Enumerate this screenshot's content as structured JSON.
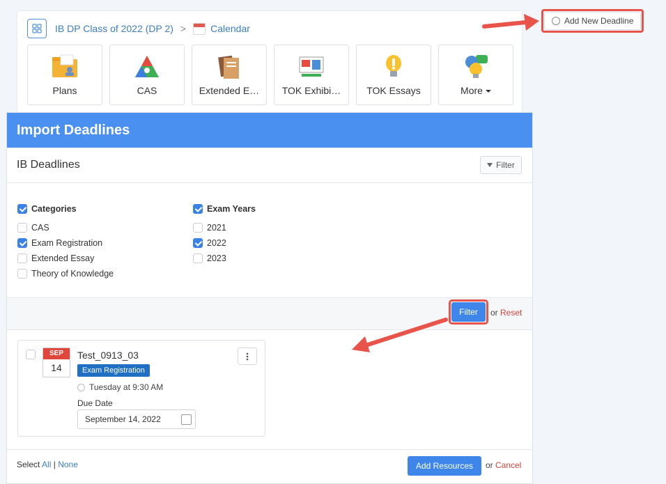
{
  "breadcrumb": {
    "class_name": "IB DP Class of 2022 (DP 2)",
    "separator": ">",
    "current": "Calendar"
  },
  "tiles": [
    {
      "label": "Plans",
      "icon": "folder-plans-icon"
    },
    {
      "label": "CAS",
      "icon": "cas-triangle-icon"
    },
    {
      "label": "Extended E…",
      "icon": "books-icon"
    },
    {
      "label": "TOK Exhibi…",
      "icon": "exhibition-board-icon"
    },
    {
      "label": "TOK Essays",
      "icon": "lightbulb-icon"
    },
    {
      "label": "More",
      "icon": "chat-bulb-icon"
    }
  ],
  "add_deadline_label": "Add New Deadline",
  "modal": {
    "title": "Import Deadlines",
    "subtitle": "IB Deadlines",
    "filter_small_label": "Filter",
    "categories": {
      "heading": "Categories",
      "items": [
        {
          "label": "CAS",
          "checked": false
        },
        {
          "label": "Exam Registration",
          "checked": true
        },
        {
          "label": "Extended Essay",
          "checked": false
        },
        {
          "label": "Theory of Knowledge",
          "checked": false
        }
      ]
    },
    "exam_years": {
      "heading": "Exam Years",
      "items": [
        {
          "label": "2021",
          "checked": false
        },
        {
          "label": "2022",
          "checked": true
        },
        {
          "label": "2023",
          "checked": false
        }
      ]
    },
    "filter_button": "Filter",
    "or_text": "or",
    "reset_link": "Reset",
    "card": {
      "month": "SEP",
      "day": "14",
      "title": "Test_0913_03",
      "tag": "Exam Registration",
      "time": "Tuesday at 9:30 AM",
      "due_label": "Due Date",
      "due_value": "September 14, 2022"
    },
    "footer": {
      "select_text": "Select",
      "all_link": "All",
      "sep": "|",
      "none_link": "None",
      "add_button": "Add Resources",
      "or_text": "or",
      "cancel_link": "Cancel"
    }
  },
  "colors": {
    "header_blue": "#4a90f0",
    "highlight_red": "#e8534a",
    "link_blue": "#3a7fc4",
    "cancel_red": "#d2433a"
  }
}
